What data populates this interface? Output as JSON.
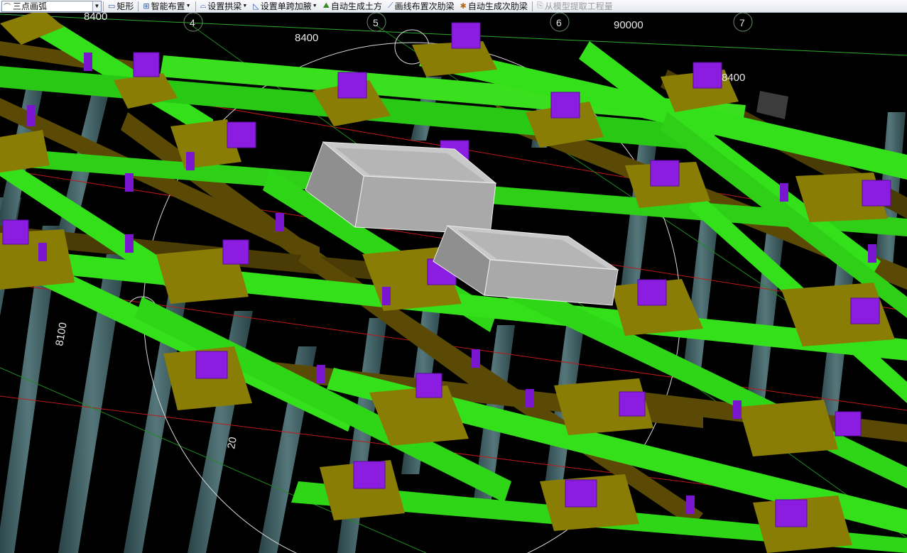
{
  "toolbar": {
    "arc_select": "三点画弧",
    "rect": "矩形",
    "smart_layout": "智能布置",
    "set_arch_beam": "设置拱梁",
    "set_span_haunch": "设置单跨加腋",
    "auto_earthwork": "自动生成土方",
    "draw_secondary_rib": "画线布置次肋梁",
    "auto_secondary_rib": "自动生成次肋梁",
    "extract_quantity": "从模型提取工程量"
  },
  "viewport": {
    "grid_bubbles": [
      "4",
      "5",
      "6",
      "7"
    ],
    "dimensions": {
      "top_left": "8400",
      "top_mid": "8400",
      "top_right_total": "90000",
      "right": "8400",
      "left_vertical": "8100",
      "lower_mid": "20"
    }
  },
  "colors": {
    "main_beam": "#33e01a",
    "secondary_beam": "#5b4a05",
    "cap": "#8a7d05",
    "column": "#4d6f73",
    "pier_block": "#8a1de0",
    "box": "#b0b0b0"
  }
}
